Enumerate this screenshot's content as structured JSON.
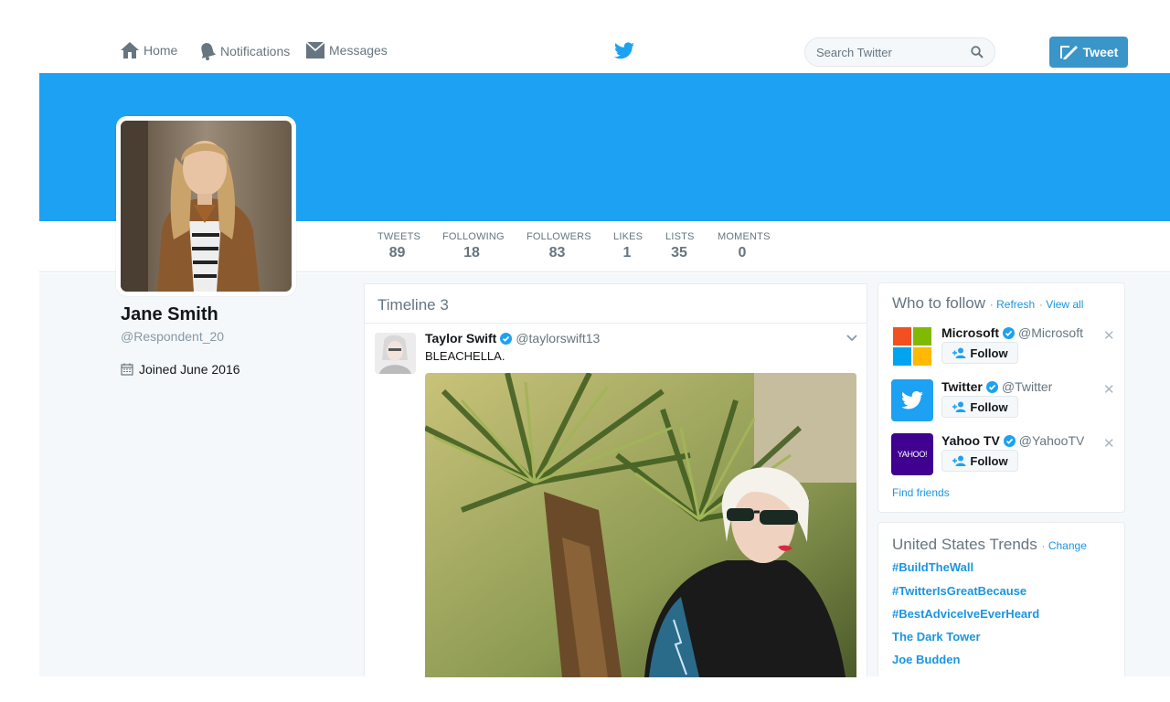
{
  "nav": {
    "home": "Home",
    "notifications": "Notifications",
    "messages": "Messages",
    "search_placeholder": "Search Twitter",
    "tweet_button": "Tweet"
  },
  "profile": {
    "name": "Jane Smith",
    "handle": "@Respondent_20",
    "joined": "Joined June 2016"
  },
  "stats": [
    {
      "label": "TWEETS",
      "value": "89"
    },
    {
      "label": "FOLLOWING",
      "value": "18"
    },
    {
      "label": "FOLLOWERS",
      "value": "83"
    },
    {
      "label": "LIKES",
      "value": "1"
    },
    {
      "label": "LISTS",
      "value": "35"
    },
    {
      "label": "MOMENTS",
      "value": "0"
    }
  ],
  "timeline": {
    "title": "Timeline 3",
    "tweet": {
      "name": "Taylor Swift",
      "handle": "@taylorswift13",
      "text": "BLEACHELLA."
    }
  },
  "who_to_follow": {
    "title": "Who to follow",
    "refresh": "Refresh",
    "view_all": "View all",
    "accounts": [
      {
        "name": "Microsoft",
        "handle": "@Microsoft",
        "follow": "Follow"
      },
      {
        "name": "Twitter",
        "handle": "@Twitter",
        "follow": "Follow"
      },
      {
        "name": "Yahoo TV",
        "handle": "@YahooTV",
        "follow": "Follow",
        "logo_text": "YAHOO!"
      }
    ],
    "find_friends": "Find friends"
  },
  "trends": {
    "title": "United States Trends",
    "change": "Change",
    "items": [
      "#BuildTheWall",
      "#TwitterIsGreatBecause",
      "#BestAdviceIveEverHeard",
      "The Dark Tower",
      "Joe Budden"
    ]
  },
  "colors": {
    "banner": "#1da1f2",
    "link": "#1b95e0",
    "tweet_button": "#3a95c8",
    "yahoo": "#400090"
  }
}
